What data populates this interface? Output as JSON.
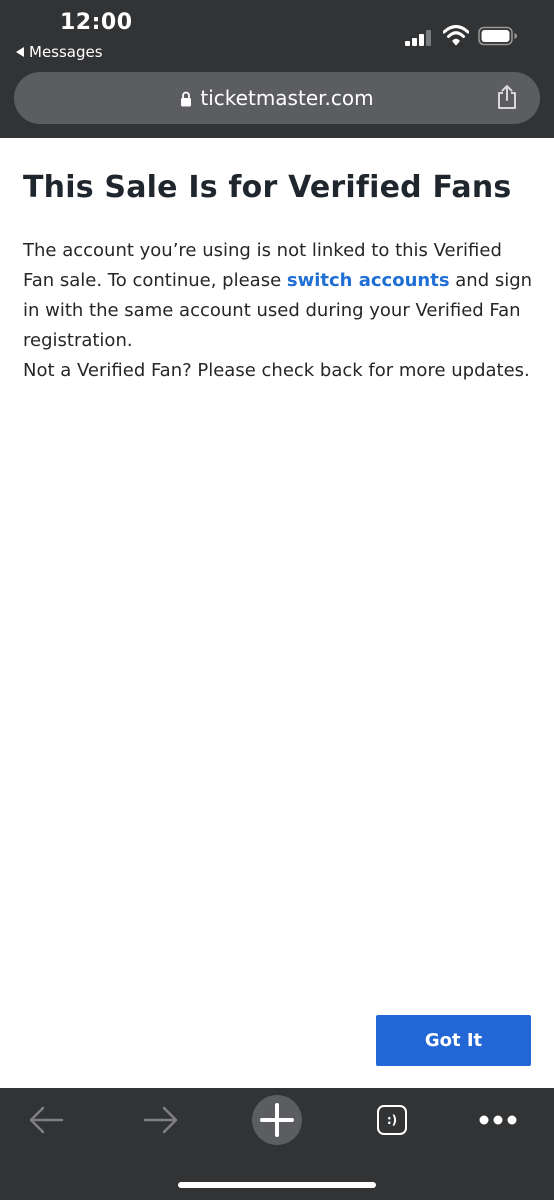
{
  "status_bar": {
    "time": "12:00",
    "back_app": "Messages"
  },
  "browser": {
    "url": "ticketmaster.com"
  },
  "page": {
    "title": "This Sale Is for Verified Fans",
    "message_part1": "The account you’re using is not linked to this Verified Fan sale. To continue, please ",
    "link_text": "switch accounts",
    "message_part2": " and sign in with the same account used during your Verified Fan registration.",
    "message_line2": "Not a Verified Fan? Please check back for more updates.",
    "button_label": "Got It"
  },
  "toolbar": {
    "tabs_label": ":)"
  },
  "icons": {
    "signal": "cellular-signal-icon",
    "wifi": "wifi-icon",
    "battery": "battery-icon",
    "lock": "lock-icon",
    "share": "share-icon",
    "back": "arrow-left-icon",
    "forward": "arrow-right-icon",
    "new_tab": "plus-icon",
    "tabs": "tabs-icon",
    "menu": "more-dots-icon"
  },
  "colors": {
    "chrome_bg": "#323335",
    "url_bar_bg": "#5c5d60",
    "link": "#1f6fd4",
    "button": "#2366d6"
  }
}
